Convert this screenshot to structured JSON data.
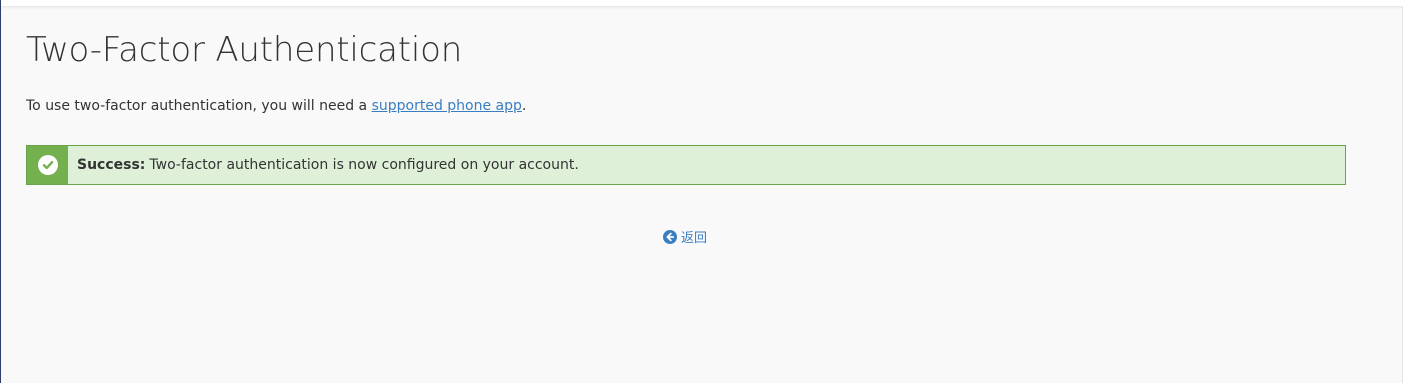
{
  "page": {
    "title": "Two-Factor Authentication",
    "intro_prefix": "To use two-factor authentication, you will need a ",
    "intro_link": "supported phone app",
    "intro_suffix": "."
  },
  "alert": {
    "type": "success",
    "label": "Success:",
    "message": "Two-factor authentication is now configured on your account.",
    "icon": "check-circle-icon"
  },
  "back": {
    "label": "返回",
    "icon": "arrow-circle-left-icon"
  },
  "colors": {
    "accent_link": "#3a7ec2",
    "success_bg": "#dff0d8",
    "success_border": "#6ba34a",
    "success_icon_bg": "#75b04f"
  }
}
